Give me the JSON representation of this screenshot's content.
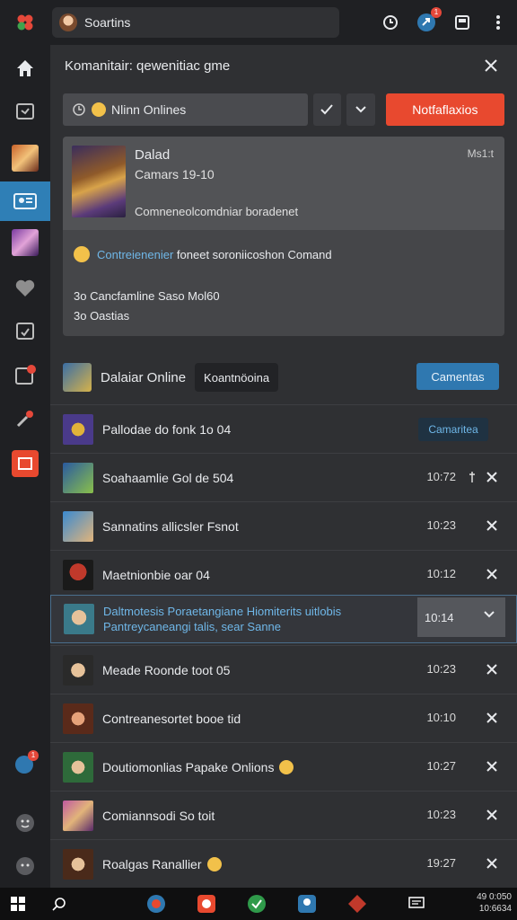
{
  "topbar": {
    "tab_title": "Soartins",
    "notif_badge": "1"
  },
  "sidebar": {
    "items": [
      {
        "name": "home-icon"
      },
      {
        "name": "inbox-icon"
      },
      {
        "name": "game-thumb-1"
      },
      {
        "name": "friends-icon",
        "active": true
      },
      {
        "name": "game-thumb-2"
      },
      {
        "name": "heart-icon"
      },
      {
        "name": "calendar-icon"
      },
      {
        "name": "alerts-icon"
      },
      {
        "name": "tools-icon"
      },
      {
        "name": "app-icon"
      }
    ],
    "bottom_badge": "1"
  },
  "panel": {
    "title": "Komanitair: qewenitiac gme",
    "search_value": "Nlinn Onlines",
    "notif_button": "Notfaflaxios",
    "card": {
      "name": "Dalad",
      "sub": "Camars 19-10",
      "status": "Ms1:t",
      "line": "Comneneolcomdniar boradenet",
      "activity_label": "Contreienenier",
      "activity_text": "foneet soroniicoshon Comand",
      "stat1": "3o Cancfamline Saso Mol60",
      "stat2": "3o Oastias"
    },
    "list_header": {
      "title": "Dalaiar Online",
      "chip": "Koantnöoina",
      "button": "Camentas"
    },
    "rows": [
      {
        "text": "Pallodae do fonk 1o 04",
        "chip": "Camaritea"
      },
      {
        "text": "Soahaamlie Gol de 504",
        "time": "10:72",
        "pin": true
      },
      {
        "text": "Sannatins allicsler Fsnot",
        "time": "10:23"
      },
      {
        "text": "Maetnionbie oar 04",
        "time": "10:12"
      },
      {
        "text": "Daltmotesis Poraetangiane Hiomiterits uitlobis",
        "text2": "Pantreycaneangi talis, sear Sanne",
        "time": "10:14",
        "highlight": true
      },
      {
        "text": "Meade Roonde toot 05",
        "time": "10:23"
      },
      {
        "text": "Contreanesortet booe tid",
        "time": "10:10"
      },
      {
        "text": "Doutiomonlias Papake Onlions",
        "time": "10:27"
      },
      {
        "text": "Comiannsodi So toit",
        "time": "10:23"
      },
      {
        "text": "Roalgas Ranallier",
        "time": "19:27"
      }
    ]
  },
  "taskbar": {
    "tray_time": "49 0:050",
    "tray_date": "10:6634"
  },
  "colors": {
    "accent_blue": "#2f78b0",
    "accent_red": "#e8492f",
    "link_blue": "#6fb7e8"
  }
}
